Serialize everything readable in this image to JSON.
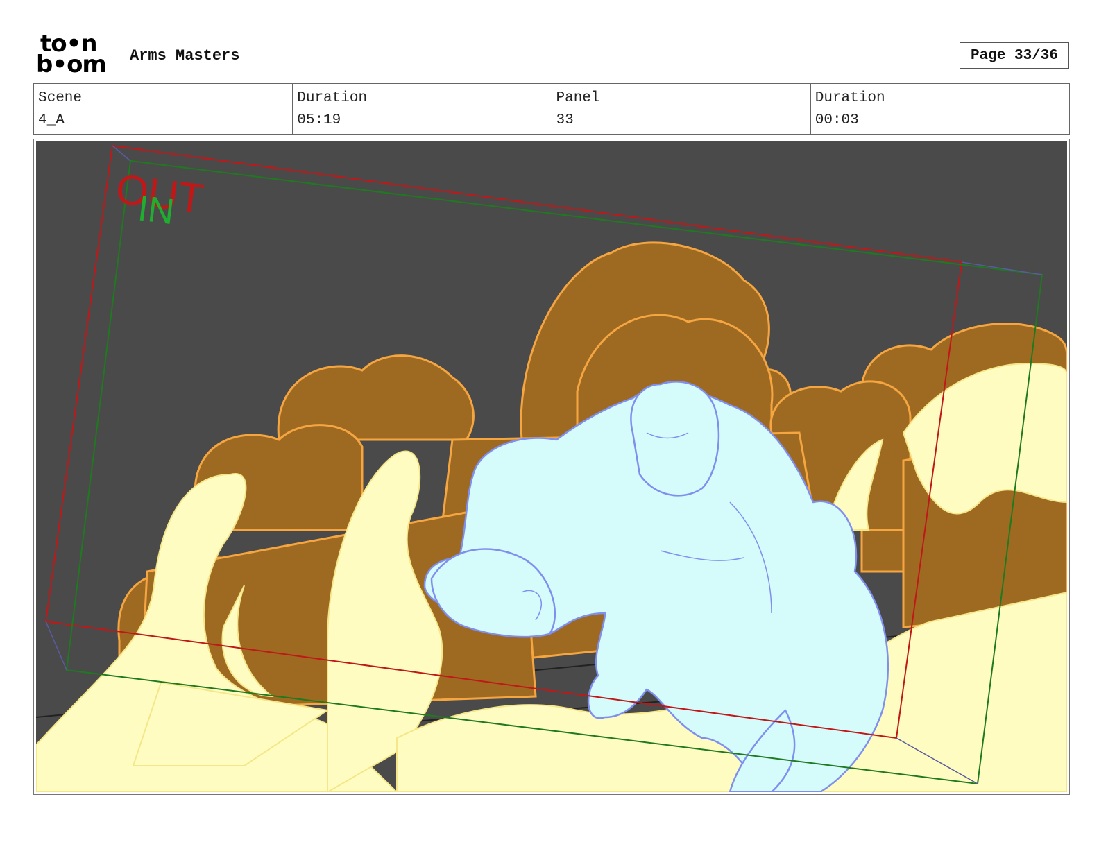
{
  "header": {
    "logo_line1": "to•n",
    "logo_line2": "b•om",
    "project_title": "Arms Masters",
    "page_label": "Page 33/36"
  },
  "info": [
    {
      "label": "Scene",
      "value": "4_A"
    },
    {
      "label": "Duration",
      "value": "05:19"
    },
    {
      "label": "Panel",
      "value": "33"
    },
    {
      "label": "Duration",
      "value": "00:03"
    }
  ],
  "panel": {
    "out_label": "OUT",
    "in_label": "IN",
    "colors": {
      "background": "#4a4a4a",
      "smoke_brown": "#9e6a22",
      "smoke_outline": "#f5a641",
      "flame_yellow": "#fefcc0",
      "character_fill": "#d6fbfb",
      "character_line": "#7f8fef",
      "out_frame": "#c01818",
      "in_frame": "#1f7a1f"
    }
  }
}
